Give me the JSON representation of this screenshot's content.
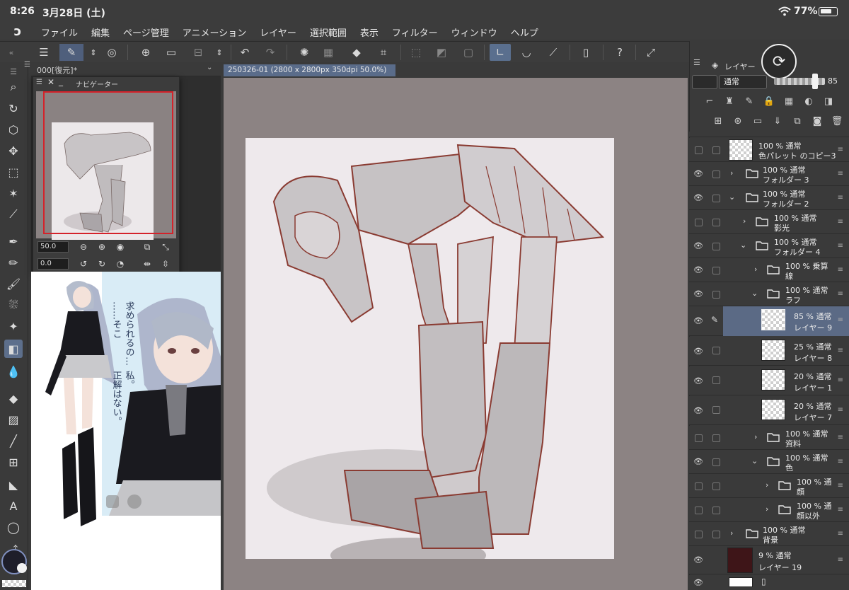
{
  "status_bar": {
    "time": "8:26",
    "date": "3月28日 (土)",
    "battery_pct": "77%",
    "battery_level": 0.77
  },
  "menu": {
    "items": [
      "ファイル",
      "編集",
      "ページ管理",
      "アニメーション",
      "レイヤー",
      "選択範囲",
      "表示",
      "フィルター",
      "ウィンドウ",
      "ヘルプ"
    ]
  },
  "subpanel": {
    "label": "000[復元]*"
  },
  "navigator": {
    "title": "ナビゲーター",
    "zoom_value": "50.0",
    "rotate_value": "0.0"
  },
  "reference": {
    "text_vertical_1": "求められるの…",
    "text_vertical_2": "……そこ",
    "text_vertical_3": "私。",
    "text_vertical_4": "正解はない。"
  },
  "canvas": {
    "tab_label": "250326-01 (2800 x 2800px 350dpi 50.0%)"
  },
  "layer_panel": {
    "tab_label": "レイヤー",
    "blend_mode": "通常",
    "opacity": "85",
    "layers": [
      {
        "l1": "100 % 通常",
        "l2": "色パレット のコピー3"
      },
      {
        "l1": "100 % 通常",
        "l2": "フォルダー 3"
      },
      {
        "l1": "100 % 通常",
        "l2": "フォルダー 2"
      },
      {
        "l1": "100 % 通常",
        "l2": "影光"
      },
      {
        "l1": "100 % 通常",
        "l2": "フォルダー 4"
      },
      {
        "l1": "100 % 乗算",
        "l2": "線"
      },
      {
        "l1": "100 % 通常",
        "l2": "ラフ"
      },
      {
        "l1": "85 % 通常",
        "l2": "レイヤー 9"
      },
      {
        "l1": "25 % 通常",
        "l2": "レイヤー 8"
      },
      {
        "l1": "20 % 通常",
        "l2": "レイヤー 1"
      },
      {
        "l1": "20 % 通常",
        "l2": "レイヤー 7"
      },
      {
        "l1": "100 % 通常",
        "l2": "資料"
      },
      {
        "l1": "100 % 通常",
        "l2": "色"
      },
      {
        "l1": "100 % 通",
        "l2": "顔"
      },
      {
        "l1": "100 % 通",
        "l2": "顔以外"
      },
      {
        "l1": "100 % 通常",
        "l2": "背景"
      },
      {
        "l1": "9 % 通常",
        "l2": "レイヤー 19"
      }
    ]
  },
  "colors": {
    "selection_blue": "#5b6a85",
    "navigator_frame": "#d4222a",
    "canvas_bg": "#8c8383",
    "paper": "#eee9ec",
    "line_art": "#8a3b32"
  }
}
